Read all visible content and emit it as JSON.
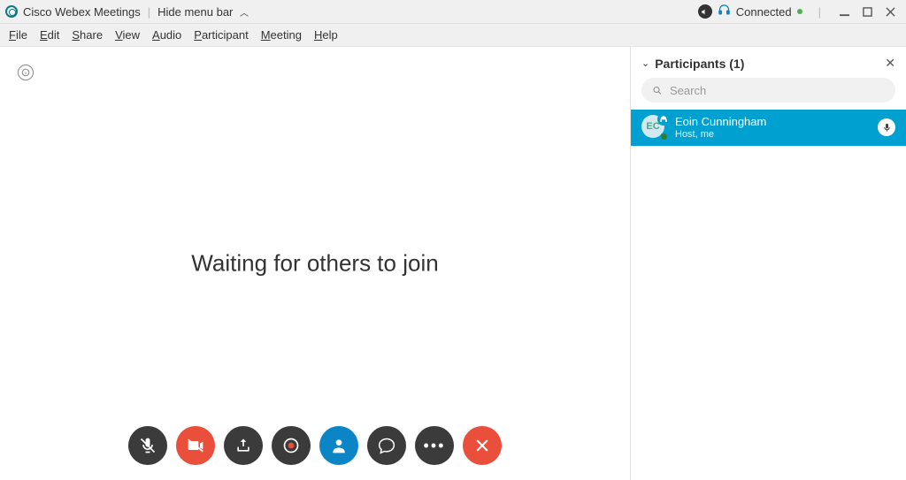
{
  "titlebar": {
    "app_name": "Cisco Webex Meetings",
    "hide_menu_label": "Hide menu bar",
    "connected_label": "Connected"
  },
  "menubar": {
    "items": [
      "File",
      "Edit",
      "Share",
      "View",
      "Audio",
      "Participant",
      "Meeting",
      "Help"
    ]
  },
  "stage": {
    "waiting_text": "Waiting for others to join"
  },
  "participants": {
    "title": "Participants",
    "count": "1",
    "search_placeholder": "Search",
    "items": [
      {
        "initials": "EC",
        "name": "Eoin  Cunningham",
        "subtitle": "Host, me"
      }
    ]
  }
}
